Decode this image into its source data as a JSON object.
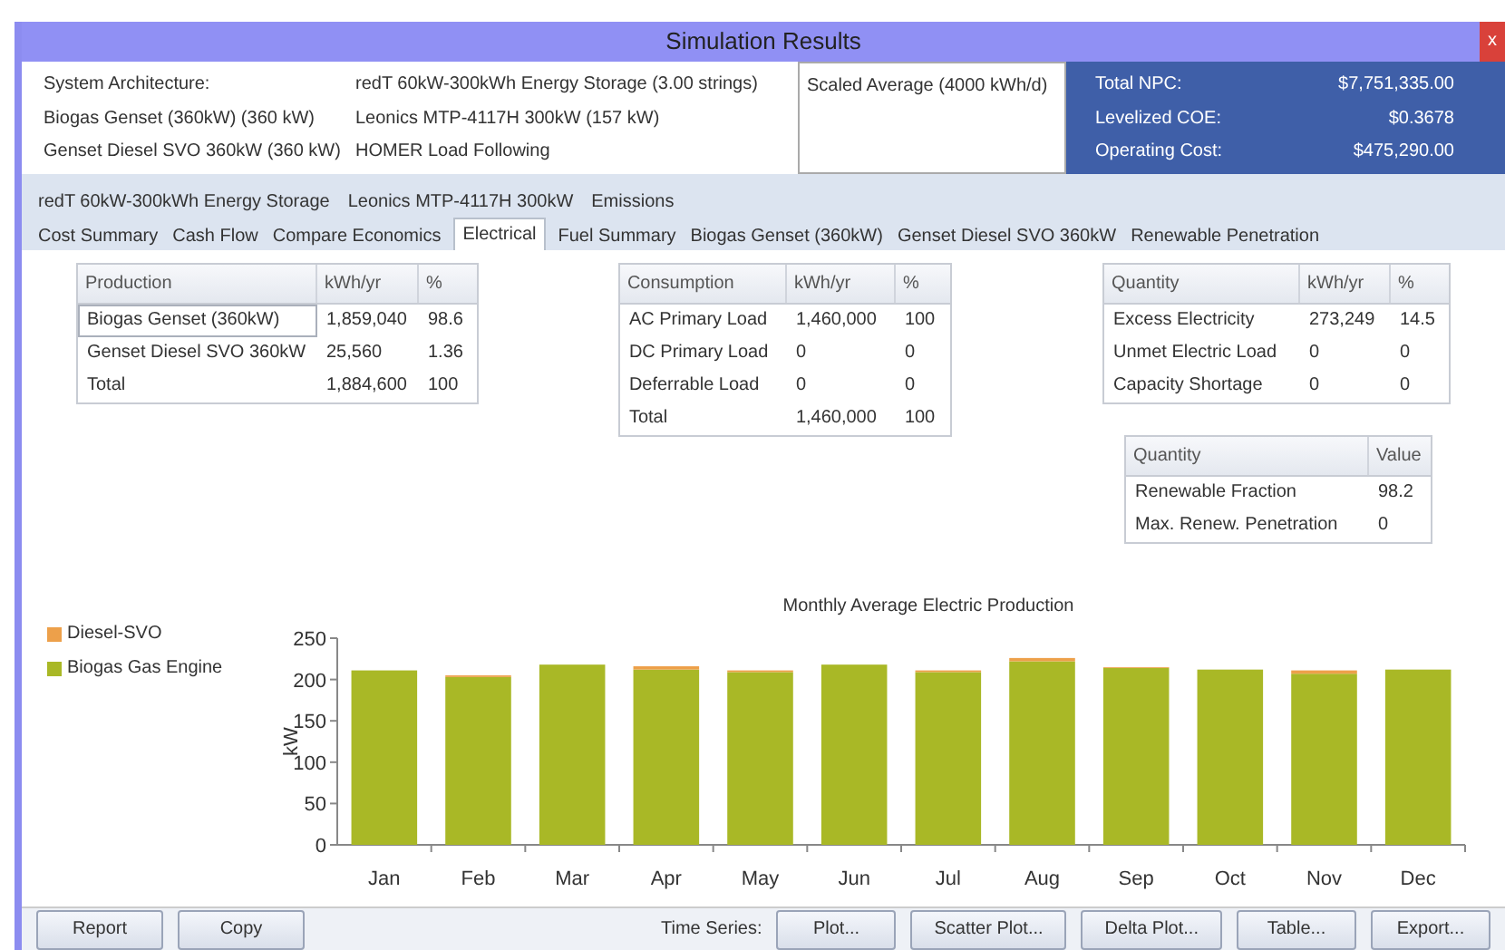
{
  "window": {
    "title": "Simulation Results",
    "close": "x"
  },
  "architecture": {
    "rows": [
      [
        "System Architecture:",
        "redT 60kW-300kWh Energy Storage (3.00 strings)"
      ],
      [
        "Biogas Genset (360kW) (360 kW)",
        "Leonics MTP-4117H 300kW (157 kW)"
      ],
      [
        "Genset Diesel SVO 360kW (360 kW)",
        "HOMER Load Following"
      ]
    ],
    "load": "Scaled Average (4000 kWh/d)"
  },
  "summary": [
    {
      "label": "Total NPC:",
      "value": "$7,751,335.00"
    },
    {
      "label": "Levelized COE:",
      "value": "$0.3678"
    },
    {
      "label": "Operating Cost:",
      "value": "$475,290.00"
    }
  ],
  "tabs_top": [
    {
      "label": "redT 60kW-300kWh Energy Storage",
      "selected": false
    },
    {
      "label": "Leonics MTP-4117H 300kW",
      "selected": false
    },
    {
      "label": "Emissions",
      "selected": false
    }
  ],
  "tabs": [
    {
      "label": "Cost Summary",
      "selected": false
    },
    {
      "label": "Cash Flow",
      "selected": false
    },
    {
      "label": "Compare Economics",
      "selected": false
    },
    {
      "label": "Electrical",
      "selected": true
    },
    {
      "label": "Fuel Summary",
      "selected": false
    },
    {
      "label": "Biogas Genset (360kW)",
      "selected": false
    },
    {
      "label": "Genset Diesel SVO 360kW",
      "selected": false
    },
    {
      "label": "Renewable Penetration",
      "selected": false
    }
  ],
  "production": {
    "columns": [
      "Production",
      "kWh/yr",
      "%"
    ],
    "rows": [
      {
        "cells": [
          "Biogas Genset (360kW)",
          "1,859,040",
          "98.6"
        ],
        "selected": true
      },
      {
        "cells": [
          "Genset Diesel SVO 360kW",
          "25,560",
          "1.36"
        ],
        "selected": false
      },
      {
        "cells": [
          "Total",
          "1,884,600",
          "100"
        ],
        "selected": false
      }
    ]
  },
  "consumption": {
    "columns": [
      "Consumption",
      "kWh/yr",
      "%"
    ],
    "rows": [
      {
        "cells": [
          "AC Primary Load",
          "1,460,000",
          "100"
        ],
        "selected": false
      },
      {
        "cells": [
          "DC Primary Load",
          "0",
          "0"
        ],
        "selected": false
      },
      {
        "cells": [
          "Deferrable Load",
          "0",
          "0"
        ],
        "selected": false
      },
      {
        "cells": [
          "Total",
          "1,460,000",
          "100"
        ],
        "selected": false
      }
    ]
  },
  "quantity": {
    "columns": [
      "Quantity",
      "kWh/yr",
      "%"
    ],
    "rows": [
      {
        "cells": [
          "Excess Electricity",
          "273,249",
          "14.5"
        ],
        "selected": false
      },
      {
        "cells": [
          "Unmet Electric Load",
          "0",
          "0"
        ],
        "selected": false
      },
      {
        "cells": [
          "Capacity Shortage",
          "0",
          "0"
        ],
        "selected": false
      }
    ]
  },
  "renewable": {
    "columns": [
      "Quantity",
      "Value"
    ],
    "rows": [
      {
        "cells": [
          "Renewable Fraction",
          "98.2"
        ],
        "selected": false
      },
      {
        "cells": [
          "Max. Renew. Penetration",
          "0"
        ],
        "selected": false
      }
    ]
  },
  "chart": {
    "chart_data": {
      "type": "bar",
      "stacked": true,
      "title": "Monthly Average Electric Production",
      "ylabel": "kW",
      "categories": [
        "Jan",
        "Feb",
        "Mar",
        "Apr",
        "May",
        "Jun",
        "Jul",
        "Aug",
        "Sep",
        "Oct",
        "Nov",
        "Dec"
      ],
      "ylim": [
        0,
        250
      ],
      "yticks": [
        0,
        50,
        100,
        150,
        200,
        250
      ],
      "series": [
        {
          "name": "Biogas Gas Engine",
          "color": "#a9b826",
          "values": [
            211,
            203,
            218,
            212,
            209,
            218,
            209,
            222,
            214,
            212,
            207,
            212
          ]
        },
        {
          "name": "Diesel-SVO",
          "color": "#eda04a",
          "values": [
            0,
            2,
            null,
            4,
            2,
            null,
            2,
            4,
            1,
            0,
            4,
            0
          ]
        }
      ]
    }
  },
  "buttons_left": [
    "Report",
    "Copy"
  ],
  "time_series_label": "Time Series:",
  "buttons_right": [
    "Plot...",
    "Scatter Plot...",
    "Delta Plot...",
    "Table...",
    "Export..."
  ]
}
